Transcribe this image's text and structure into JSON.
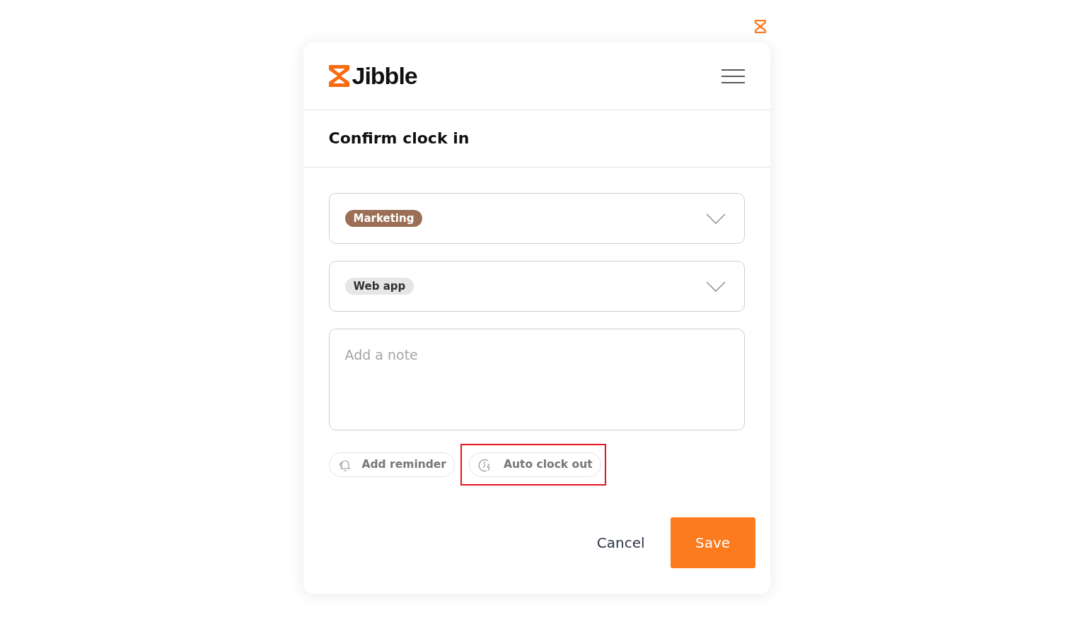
{
  "brand": {
    "name": "Jibble"
  },
  "title": "Confirm clock in",
  "selects": [
    {
      "tag": "Marketing",
      "color": "#9b6f55"
    },
    {
      "tag": "Web app",
      "color": "#e6e6e6"
    }
  ],
  "note": {
    "placeholder": "Add a note"
  },
  "chips": [
    {
      "label": "Add reminder",
      "kind": "reminder",
      "highlighted": false
    },
    {
      "label": "Auto clock out",
      "kind": "autoclock",
      "highlighted": true
    }
  ],
  "buttons": [
    {
      "label": "Cancel",
      "kind": "link"
    },
    {
      "label": "Save",
      "kind": "primary"
    }
  ]
}
